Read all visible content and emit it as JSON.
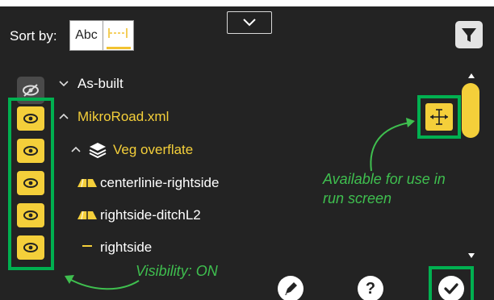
{
  "header": {
    "sort_label": "Sort by:",
    "sort_abc_label": "Abc",
    "sort_length_icon": "length-icon",
    "dropdown_icon": "chevron-down-icon",
    "filter_icon": "filter-icon"
  },
  "layers": {
    "visibility_toggle_icon": "eye-slash-icon",
    "items": [
      {
        "label": "As-built",
        "expander_icon": "chevron-down-icon"
      },
      {
        "label": "MikroRoad.xml",
        "expander_icon": "chevron-up-icon",
        "visibility": "on"
      },
      {
        "label": "Veg overflate",
        "expander_icon": "chevron-up-icon",
        "type_icon": "layers-icon",
        "visibility": "on"
      },
      {
        "label": "centerlinie-rightside",
        "type_icon": "surface-icon",
        "visibility": "on"
      },
      {
        "label": "rightside-ditchL2",
        "type_icon": "surface-icon",
        "visibility": "on"
      },
      {
        "label": "rightside",
        "type_icon": "line-icon",
        "visibility": "on"
      }
    ]
  },
  "annotations": {
    "run_screen_line1": "Available for use in",
    "run_screen_line2": "run screen",
    "visibility": "Visibility: ON"
  },
  "toolbar": {
    "edit_icon": "pencil-icon",
    "help_label": "?",
    "confirm_icon": "checkmark-icon",
    "move_icon": "move-icon"
  },
  "colors": {
    "background": "#232323",
    "accent_yellow": "#f4cf3a",
    "annotation_green": "#00b050"
  }
}
